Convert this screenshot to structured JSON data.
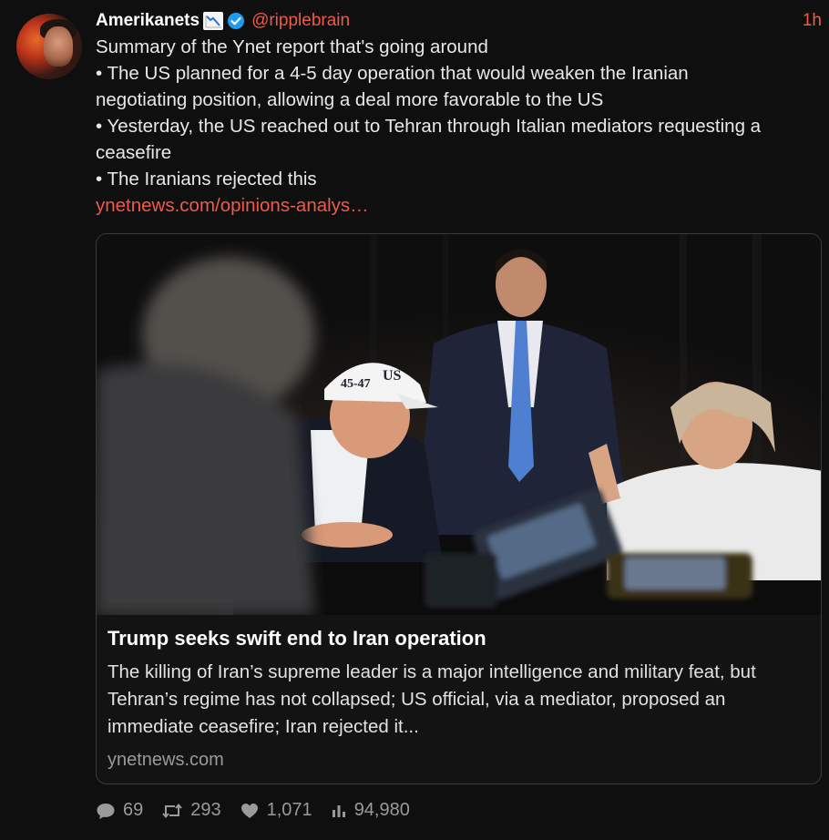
{
  "user": {
    "display_name": "Amerikanets",
    "handle": "@ripplebrain",
    "time": "1h",
    "emoji": "chart-decreasing-icon",
    "verified": "verified-icon"
  },
  "post": {
    "lines": [
      "Summary of the Ynet report that's going around",
      "• The US planned for a 4-5 day operation that would weaken the Iranian",
      "negotiating position, allowing a deal more favorable to the US",
      "• Yesterday, the US reached out to Tehran through Italian mediators requesting a",
      "ceasefire",
      "• The Iranians rejected this"
    ],
    "link": "ynetnews.com/opinions-analys…"
  },
  "card": {
    "title": "Trump seeks swift end to Iran operation",
    "description": "The killing of Iran’s supreme leader is a major intelligence and military feat, but Tehran’s regime has not collapsed; US official, via a mediator, proposed an immediate ceasefire; Iran rejected it...",
    "domain": "ynetnews.com",
    "image_hat_text_left": "45-47",
    "image_hat_text_right": "US"
  },
  "stats": {
    "replies": "69",
    "reposts": "293",
    "likes": "1,071",
    "views": "94,980"
  },
  "colors": {
    "accent": "#f05a4a",
    "background": "#0f0f0f",
    "verified": "#1d9bf0"
  }
}
